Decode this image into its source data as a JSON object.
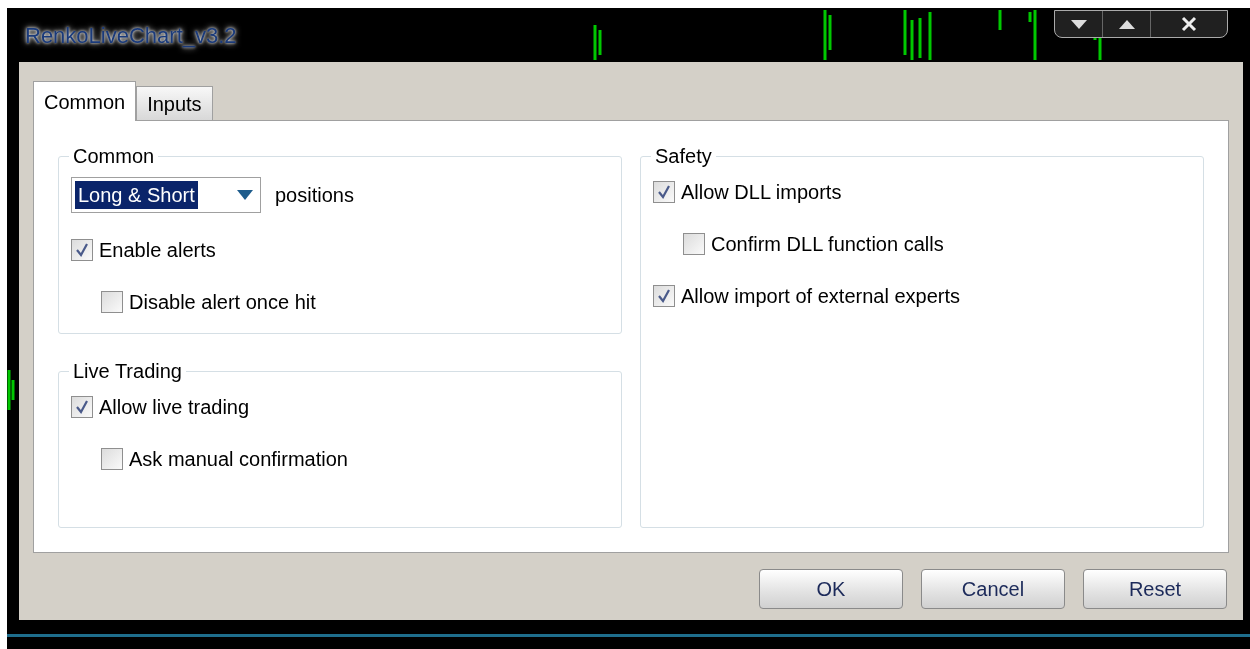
{
  "window": {
    "title": "RenkoLiveChart_v3.2"
  },
  "tabs": [
    {
      "label": "Common",
      "selected": true
    },
    {
      "label": "Inputs",
      "selected": false
    }
  ],
  "groups": [
    {
      "title": "Common",
      "dropdown": {
        "value": "Long & Short",
        "suffix": "positions"
      },
      "options": [
        {
          "label": "Enable alerts",
          "checked": true,
          "children": [
            {
              "label": "Disable alert once hit",
              "checked": false
            }
          ]
        }
      ]
    },
    {
      "title": "Live Trading",
      "options": [
        {
          "label": "Allow live trading",
          "checked": true,
          "children": [
            {
              "label": "Ask manual confirmation",
              "checked": false
            }
          ]
        }
      ]
    },
    {
      "title": "Safety",
      "options": [
        {
          "label": "Allow DLL imports",
          "checked": true,
          "children": [
            {
              "label": "Confirm DLL function calls",
              "checked": false
            }
          ]
        },
        {
          "label": "Allow import of external experts",
          "checked": true
        }
      ]
    }
  ],
  "buttons": [
    "OK",
    "Cancel",
    "Reset"
  ]
}
